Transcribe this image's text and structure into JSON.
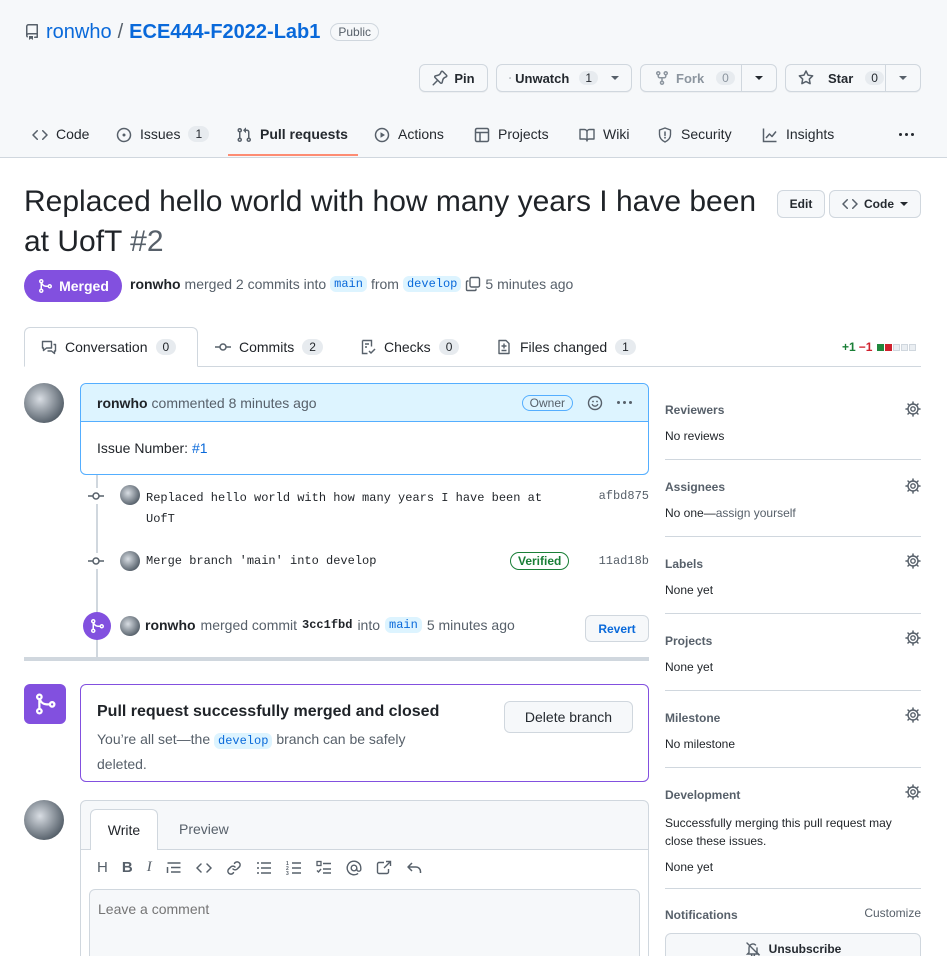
{
  "repo": {
    "owner": "ronwho",
    "separator": "/",
    "name": "ECE444-F2022-Lab1",
    "visibility": "Public"
  },
  "header_buttons": {
    "pin": "Pin",
    "unwatch": "Unwatch",
    "unwatch_count": "1",
    "fork": "Fork",
    "fork_count": "0",
    "star": "Star",
    "star_count": "0"
  },
  "nav": {
    "code": "Code",
    "issues": "Issues",
    "issues_count": "1",
    "pull_requests": "Pull requests",
    "actions": "Actions",
    "projects": "Projects",
    "wiki": "Wiki",
    "security": "Security",
    "insights": "Insights"
  },
  "pr": {
    "title": "Replaced hello world with how many years I have been at UofT",
    "number": "#2",
    "edit": "Edit",
    "code": "Code",
    "state": "Merged",
    "author": "ronwho",
    "merged_text": "merged 2 commits into",
    "base": "main",
    "from_text": "from",
    "head": "develop",
    "time": "5 minutes ago"
  },
  "tabs": {
    "conversation": "Conversation",
    "conversation_count": "0",
    "commits": "Commits",
    "commits_count": "2",
    "checks": "Checks",
    "checks_count": "0",
    "files": "Files changed",
    "files_count": "1",
    "additions": "+1",
    "deletions": "−1"
  },
  "comment": {
    "author": "ronwho",
    "action": "commented 8 minutes ago",
    "role": "Owner",
    "body_label": "Issue Number:",
    "body_link": "#1"
  },
  "commits": [
    {
      "message_line1": "Replaced hello world with how many years I have been at",
      "message_line2": "UofT",
      "sha": "afbd875"
    },
    {
      "message_line1": "Merge branch 'main' into develop",
      "badge": "Verified",
      "sha": "11ad18b"
    }
  ],
  "merge_event": {
    "author": "ronwho",
    "text1": "merged commit",
    "commit": "3cc1fbd",
    "text2": "into",
    "branch": "main",
    "time": "5 minutes ago",
    "revert": "Revert"
  },
  "merged_box": {
    "title": "Pull request successfully merged and closed",
    "text1": "You’re all set—the",
    "branch": "develop",
    "text2": "branch can be safely",
    "text3": "deleted.",
    "delete_button": "Delete branch"
  },
  "composer": {
    "write_tab": "Write",
    "preview_tab": "Preview",
    "placeholder": "Leave a comment"
  },
  "sidebar": {
    "reviewers_title": "Reviewers",
    "reviewers_value": "No reviews",
    "assignees_title": "Assignees",
    "assignees_value": "No one—",
    "assignees_link": "assign yourself",
    "labels_title": "Labels",
    "labels_value": "None yet",
    "projects_title": "Projects",
    "projects_value": "None yet",
    "milestone_title": "Milestone",
    "milestone_value": "No milestone",
    "development_title": "Development",
    "development_desc": "Successfully merging this pull request may close these issues.",
    "development_value": "None yet",
    "notifications_title": "Notifications",
    "customize": "Customize",
    "unsubscribe": "Unsubscribe"
  },
  "colors": {
    "merged_purple": "#8250df",
    "link_blue": "#0969da",
    "nav_underline": "#fd8c73",
    "addition_green": "#1a7f37",
    "deletion_red": "#cf222e"
  }
}
